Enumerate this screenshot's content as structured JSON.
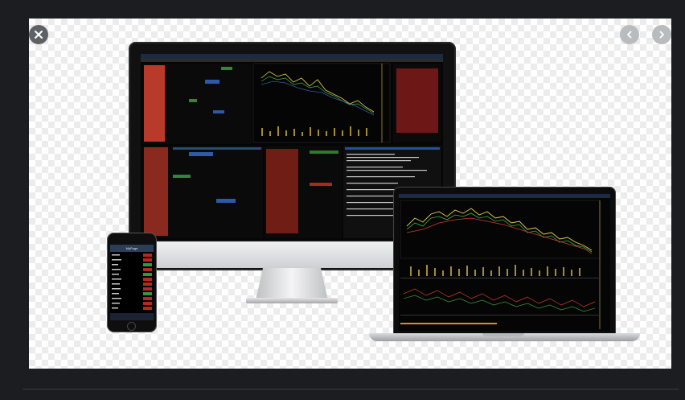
{
  "viewer": {
    "close_icon": "close-icon",
    "prev_icon": "chevron-left-icon",
    "next_icon": "chevron-right-icon"
  },
  "image": {
    "phone_header": "MyPage"
  },
  "colors": {
    "page_bg": "#1b1d20",
    "control_dark": "#5e6166",
    "control_light": "#b9bcbf"
  }
}
